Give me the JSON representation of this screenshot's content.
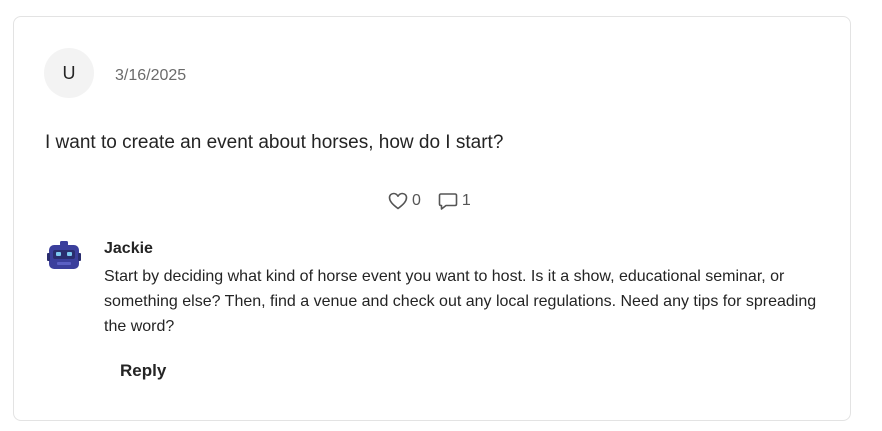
{
  "post": {
    "avatar_initial": "U",
    "date": "3/16/2025",
    "body": "I want to create an event about horses, how do I start?",
    "like_count": "0",
    "comment_count": "1"
  },
  "reply": {
    "author": "Jackie",
    "text": "Start by deciding what kind of horse event you want to host. Is it a show, educational seminar, or something else? Then, find a venue and check out any local regulations. Need any tips for spreading the word?",
    "avatar_icon": "robot-icon"
  },
  "actions": {
    "reply_label": "Reply"
  },
  "icons": {
    "like": "heart-icon",
    "comment": "comment-icon"
  },
  "colors": {
    "bot_avatar": "#3b3f9c",
    "avatar_bg": "#f3f3f3"
  }
}
